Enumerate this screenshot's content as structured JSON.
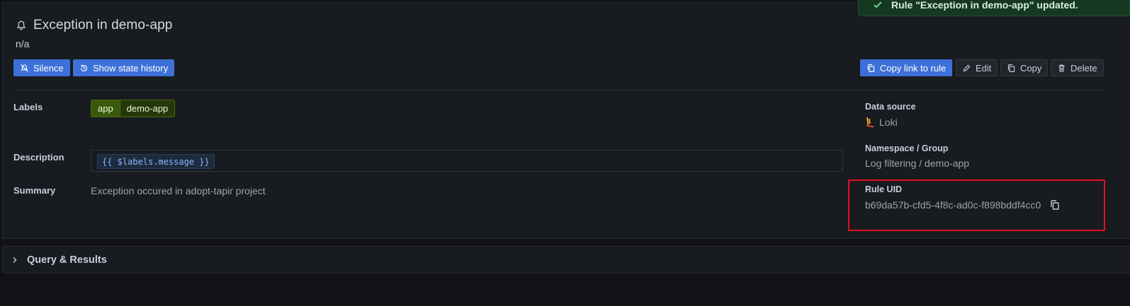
{
  "toast": {
    "text": "Rule \"Exception in demo-app\" updated."
  },
  "rule": {
    "title": "Exception in demo-app",
    "subtitle": "n/a"
  },
  "actions_left": {
    "silence": "Silence",
    "state_history": "Show state history"
  },
  "actions_right": {
    "copy_link": "Copy link to rule",
    "edit": "Edit",
    "copy": "Copy",
    "delete": "Delete"
  },
  "details": {
    "labels_title": "Labels",
    "label_key": "app",
    "label_value": "demo-app",
    "description_title": "Description",
    "description_value": "{{ $labels.message }}",
    "summary_title": "Summary",
    "summary_value": "Exception occured in adopt-tapir project"
  },
  "side": {
    "datasource_title": "Data source",
    "datasource_value": "Loki",
    "namespace_title": "Namespace / Group",
    "namespace_value": "Log filtering / demo-app",
    "uid_title": "Rule UID",
    "uid_value": "b69da57b-cfd5-4f8c-ad0c-f898bddf4cc0"
  },
  "query": {
    "label": "Query & Results"
  },
  "colors": {
    "primary": "#3d71d9",
    "label_key_bg": "#3a5a0a",
    "highlight": "#e0101f",
    "toast_bg": "#163821"
  }
}
